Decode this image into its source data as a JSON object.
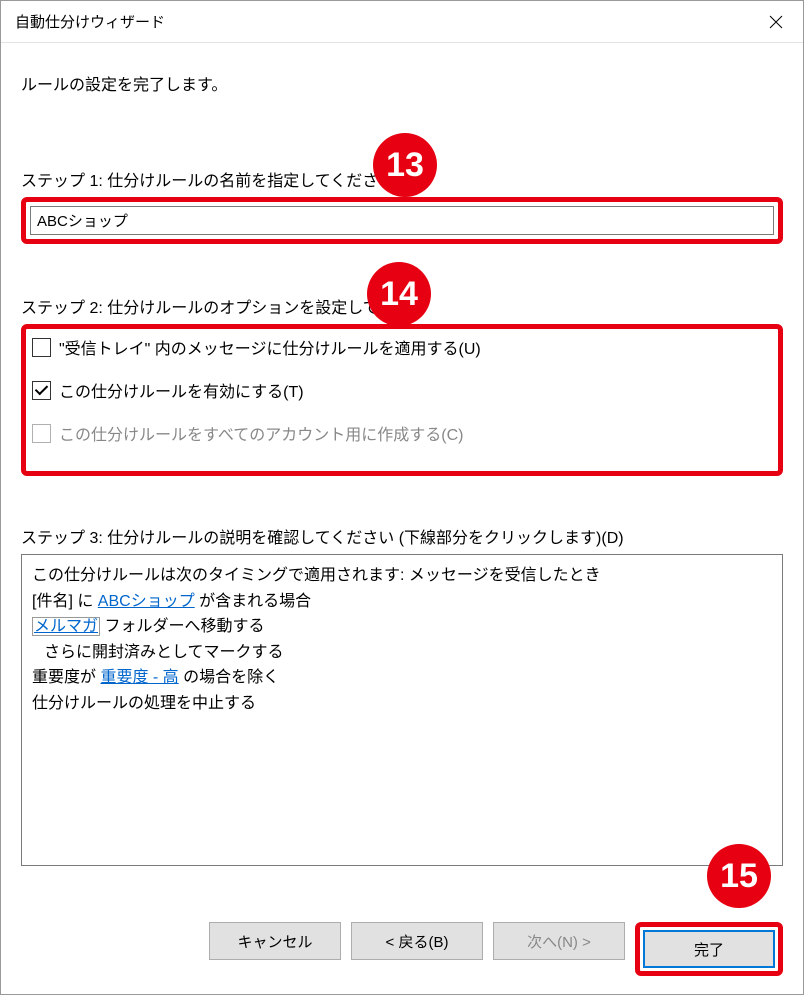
{
  "titlebar": {
    "title": "自動仕分けウィザード"
  },
  "intro": "ルールの設定を完了します。",
  "step1": {
    "label": "ステップ 1: 仕分けルールの名前を指定してください",
    "value": "ABCショップ"
  },
  "step2": {
    "label": "ステップ 2: 仕分けルールのオプションを設定してくだ",
    "opt1": {
      "label": "\"受信トレイ\" 内のメッセージに仕分けルールを適用する(U)",
      "checked": false,
      "disabled": false
    },
    "opt2": {
      "label": "この仕分けルールを有効にする(T)",
      "checked": true,
      "disabled": false
    },
    "opt3": {
      "label": "この仕分けルールをすべてのアカウント用に作成する(C)",
      "checked": false,
      "disabled": true
    }
  },
  "step3": {
    "label": "ステップ 3: 仕分けルールの説明を確認してください (下線部分をクリックします)(D)",
    "line1": "この仕分けルールは次のタイミングで適用されます: メッセージを受信したとき",
    "line2_pre": "[件名] に ",
    "line2_link": "ABCショップ",
    "line2_post": " が含まれる場合",
    "line3_link": "メルマガ",
    "line3_post": " フォルダーへ移動する",
    "line4": "さらに開封済みとしてマークする",
    "line5_pre": "重要度が ",
    "line5_link": "重要度 - 高",
    "line5_post": " の場合を除く",
    "line6": "仕分けルールの処理を中止する"
  },
  "buttons": {
    "cancel": "キャンセル",
    "back": "< 戻る(B)",
    "next": "次へ(N) >",
    "finish": "完了"
  },
  "annotations": {
    "a13": "13",
    "a14": "14",
    "a15": "15"
  }
}
